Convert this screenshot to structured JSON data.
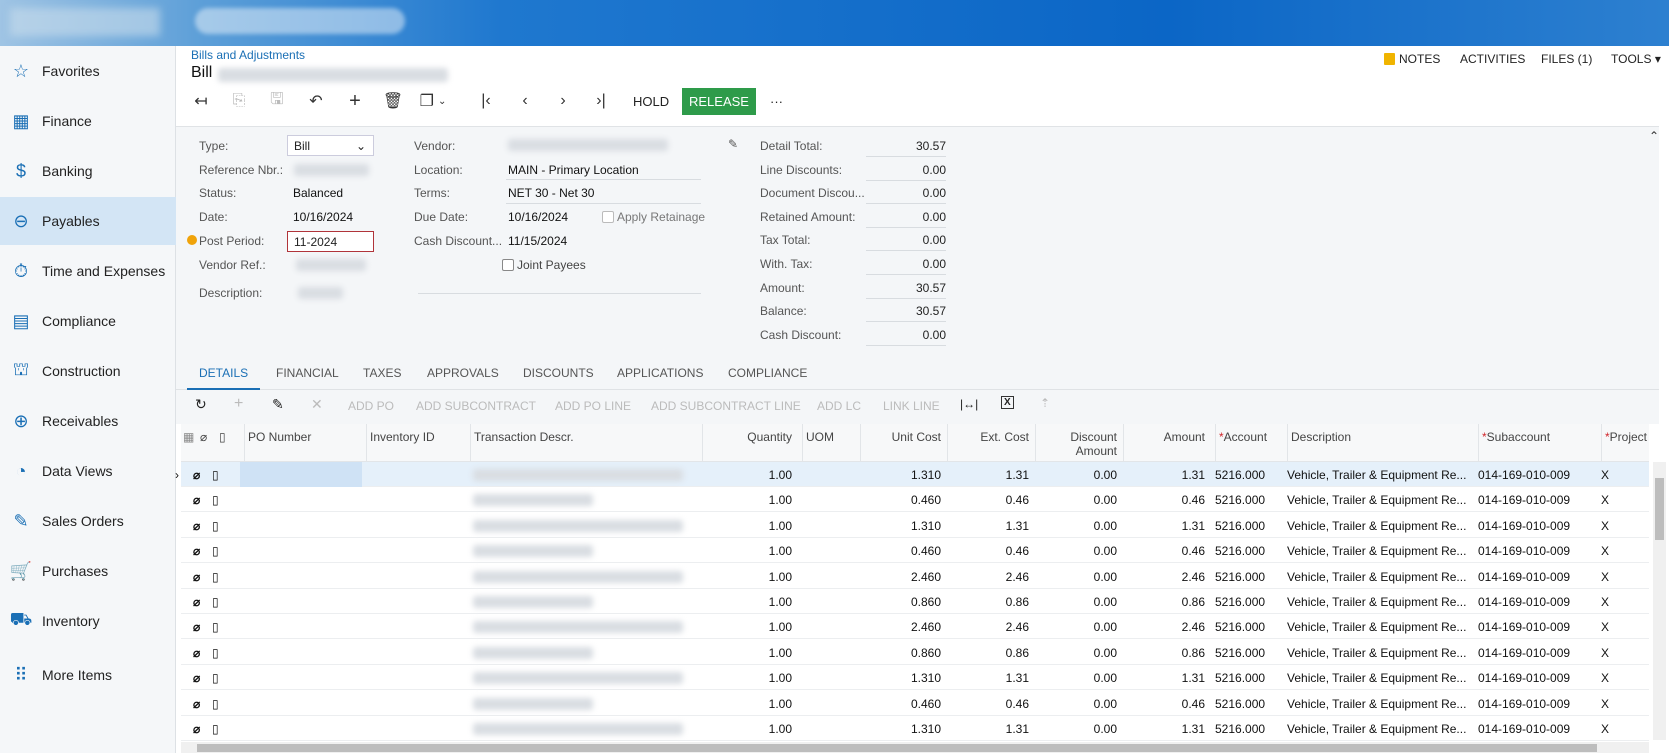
{
  "colors": {
    "topbar": "#0b66c6",
    "accent": "#1a6fb5",
    "release": "#2e9b4a",
    "warning": "#f0a30a"
  },
  "sidebar": {
    "items": [
      {
        "label": "Favorites",
        "icon": "star-icon",
        "glyph": "☆"
      },
      {
        "label": "Finance",
        "icon": "calculator-icon",
        "glyph": "▦"
      },
      {
        "label": "Banking",
        "icon": "dollar-icon",
        "glyph": "$"
      },
      {
        "label": "Payables",
        "icon": "minus-circle-icon",
        "glyph": "⊖",
        "active": true
      },
      {
        "label": "Time and Expenses",
        "icon": "stopwatch-icon",
        "glyph": "⏱"
      },
      {
        "label": "Compliance",
        "icon": "checklist-icon",
        "glyph": "▤"
      },
      {
        "label": "Construction",
        "icon": "crane-icon",
        "glyph": "⛫"
      },
      {
        "label": "Receivables",
        "icon": "plus-circle-icon",
        "glyph": "⊕"
      },
      {
        "label": "Data Views",
        "icon": "pie-chart-icon",
        "glyph": "◔"
      },
      {
        "label": "Sales Orders",
        "icon": "edit-icon",
        "glyph": "✎"
      },
      {
        "label": "Purchases",
        "icon": "cart-icon",
        "glyph": "🛒"
      },
      {
        "label": "Inventory",
        "icon": "truck-icon",
        "glyph": "⛟"
      },
      {
        "label": "More Items",
        "icon": "grid-dots-icon",
        "glyph": "⠿"
      }
    ]
  },
  "header": {
    "breadcrumb": "Bills and Adjustments",
    "title": "Bill",
    "notes": "NOTES",
    "activities": "ACTIVITIES",
    "files": "FILES (1)",
    "tools": "TOOLS"
  },
  "toolbar": {
    "hold": "HOLD",
    "release": "RELEASE",
    "more": "···"
  },
  "form": {
    "type_label": "Type:",
    "type_value": "Bill",
    "ref_label": "Reference Nbr.:",
    "status_label": "Status:",
    "status_value": "Balanced",
    "date_label": "Date:",
    "date_value": "10/16/2024",
    "post_label": "Post Period:",
    "post_value": "11-2024",
    "vref_label": "Vendor Ref.:",
    "desc_label": "Description:",
    "vendor_label": "Vendor:",
    "location_label": "Location:",
    "location_value": "MAIN - Primary Location",
    "terms_label": "Terms:",
    "terms_value": "NET 30 - Net 30",
    "due_label": "Due Date:",
    "due_value": "10/16/2024",
    "apply_retainage": "Apply Retainage",
    "cashdisc_label": "Cash Discount...",
    "cashdisc_value": "11/15/2024",
    "joint_payees": "Joint Payees",
    "totals": [
      {
        "label": "Detail Total:",
        "value": "30.57"
      },
      {
        "label": "Line Discounts:",
        "value": "0.00"
      },
      {
        "label": "Document Discou...",
        "value": "0.00"
      },
      {
        "label": "Retained Amount:",
        "value": "0.00"
      },
      {
        "label": "Tax Total:",
        "value": "0.00"
      },
      {
        "label": "With. Tax:",
        "value": "0.00"
      },
      {
        "label": "Amount:",
        "value": "30.57"
      },
      {
        "label": "Balance:",
        "value": "30.57"
      },
      {
        "label": "Cash Discount:",
        "value": "0.00"
      }
    ]
  },
  "tabs": [
    "DETAILS",
    "FINANCIAL",
    "TAXES",
    "APPROVALS",
    "DISCOUNTS",
    "APPLICATIONS",
    "COMPLIANCE"
  ],
  "grid_toolbar": [
    "ADD PO",
    "ADD SUBCONTRACT",
    "ADD PO LINE",
    "ADD SUBCONTRACT LINE",
    "ADD LC",
    "LINK LINE"
  ],
  "grid": {
    "columns": [
      "PO Number",
      "Inventory ID",
      "Transaction Descr.",
      "Quantity",
      "UOM",
      "Unit Cost",
      "Ext. Cost",
      "Discount Amount",
      "Amount",
      "Account",
      "Description",
      "Subaccount",
      "Project"
    ],
    "rows": [
      [
        "1.00",
        "1.310",
        "1.31",
        "0.00",
        "1.31",
        "5216.000",
        "Vehicle, Trailer & Equipment Re...",
        "014-169-010-009",
        "X"
      ],
      [
        "1.00",
        "0.460",
        "0.46",
        "0.00",
        "0.46",
        "5216.000",
        "Vehicle, Trailer & Equipment Re...",
        "014-169-010-009",
        "X"
      ],
      [
        "1.00",
        "1.310",
        "1.31",
        "0.00",
        "1.31",
        "5216.000",
        "Vehicle, Trailer & Equipment Re...",
        "014-169-010-009",
        "X"
      ],
      [
        "1.00",
        "0.460",
        "0.46",
        "0.00",
        "0.46",
        "5216.000",
        "Vehicle, Trailer & Equipment Re...",
        "014-169-010-009",
        "X"
      ],
      [
        "1.00",
        "2.460",
        "2.46",
        "0.00",
        "2.46",
        "5216.000",
        "Vehicle, Trailer & Equipment Re...",
        "014-169-010-009",
        "X"
      ],
      [
        "1.00",
        "0.860",
        "0.86",
        "0.00",
        "0.86",
        "5216.000",
        "Vehicle, Trailer & Equipment Re...",
        "014-169-010-009",
        "X"
      ],
      [
        "1.00",
        "2.460",
        "2.46",
        "0.00",
        "2.46",
        "5216.000",
        "Vehicle, Trailer & Equipment Re...",
        "014-169-010-009",
        "X"
      ],
      [
        "1.00",
        "0.860",
        "0.86",
        "0.00",
        "0.86",
        "5216.000",
        "Vehicle, Trailer & Equipment Re...",
        "014-169-010-009",
        "X"
      ],
      [
        "1.00",
        "1.310",
        "1.31",
        "0.00",
        "1.31",
        "5216.000",
        "Vehicle, Trailer & Equipment Re...",
        "014-169-010-009",
        "X"
      ],
      [
        "1.00",
        "0.460",
        "0.46",
        "0.00",
        "0.46",
        "5216.000",
        "Vehicle, Trailer & Equipment Re...",
        "014-169-010-009",
        "X"
      ],
      [
        "1.00",
        "1.310",
        "1.31",
        "0.00",
        "1.31",
        "5216.000",
        "Vehicle, Trailer & Equipment Re...",
        "014-169-010-009",
        "X"
      ]
    ]
  }
}
